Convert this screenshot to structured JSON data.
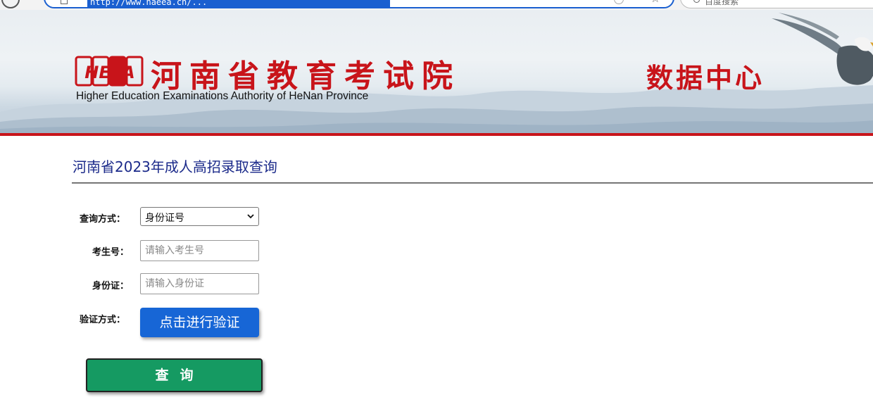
{
  "browser": {
    "url": "http://www.haeea.cn/...",
    "search_placeholder": "百度搜索"
  },
  "header": {
    "logo_text": "HEEA",
    "title": "河南省教育考试院",
    "subtitle": "Higher Education Examinations Authority of HeNan Province",
    "section_name": "数据中心"
  },
  "main": {
    "page_title": "河南省2023年成人高招录取查询",
    "form": {
      "query_mode_label": "查询方式：",
      "query_mode_value": "身份证号",
      "exam_no_label": "考生号：",
      "exam_no_value": "",
      "exam_no_placeholder": "请输入考生号",
      "id_card_label": "身份证：",
      "id_card_value": "",
      "id_card_placeholder": "请输入身份证",
      "verify_label": "验证方式：",
      "verify_button": "点击进行验证",
      "query_button": "查询"
    }
  },
  "colors": {
    "brand_red": "#c8141a",
    "title_blue": "#1b2a8a",
    "verify_blue": "#1766d6",
    "query_green": "#159a62"
  },
  "icons": {
    "query_mode_dropdown": "chevron-down-icon",
    "banner_decoration": "eagle-icon"
  }
}
